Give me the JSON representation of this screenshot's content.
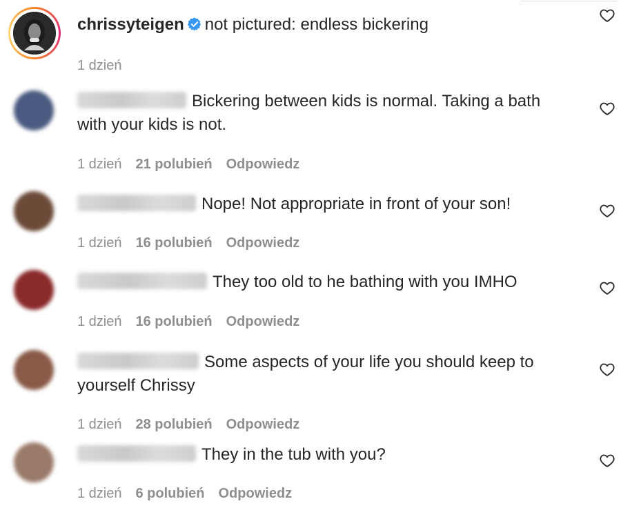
{
  "post": {
    "username": "chrissyteigen",
    "caption": "not pictured: endless bickering",
    "time": "1 dzień",
    "verified_icon": "verified-badge-icon",
    "like_icon": "heart-outline-icon"
  },
  "comments": [
    {
      "lines": [
        "Bickering between kids is normal. Taking a bath",
        "with your kids is not."
      ],
      "time": "1 dzień",
      "likes": "21 polubień",
      "reply": "Odpowiedz",
      "avatar_color": "#4a5a80"
    },
    {
      "lines": [
        "Nope! Not appropriate in front of your son!"
      ],
      "time": "1 dzień",
      "likes": "16 polubień",
      "reply": "Odpowiedz",
      "avatar_color": "#6b4a38"
    },
    {
      "lines": [
        "They too old to he bathing with you IMHO"
      ],
      "time": "1 dzień",
      "likes": "16 polubień",
      "reply": "Odpowiedz",
      "avatar_color": "#8a2a2a"
    },
    {
      "lines": [
        "Some aspects of your life you should keep to",
        "yourself Chrissy"
      ],
      "time": "1 dzień",
      "likes": "28 polubień",
      "reply": "Odpowiedz",
      "avatar_color": "#8a5a48"
    },
    {
      "lines": [
        "They in the tub with you?"
      ],
      "time": "1 dzień",
      "likes": "6 polubień",
      "reply": "Odpowiedz",
      "avatar_color": "#9a7a6a"
    }
  ]
}
